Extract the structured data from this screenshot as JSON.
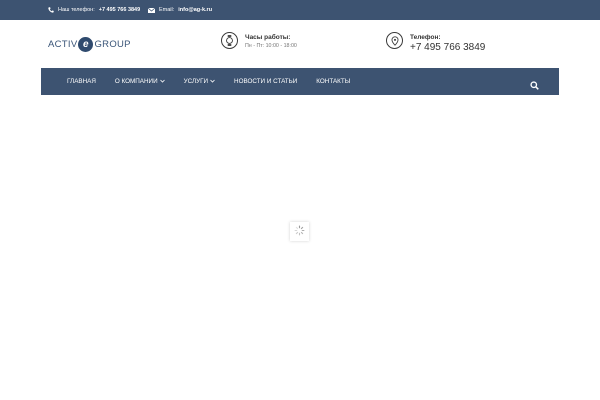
{
  "topbar": {
    "phone_label": "Наш телефон:",
    "phone_value": "+7 495 766 3849",
    "email_label": "Email:",
    "email_value": "info@ag-k.ru"
  },
  "header": {
    "logo": {
      "part1": "ACTIV",
      "part2": "e",
      "part3": "GROUP"
    },
    "hours": {
      "title": "Часы работы:",
      "value": "Пн - Пт: 10:00 - 18:00"
    },
    "phone": {
      "title": "Телефон:",
      "value": "+7 495 766 3849"
    }
  },
  "nav": {
    "items": [
      {
        "label": "ГЛАВНАЯ",
        "dropdown": false
      },
      {
        "label": "О КОМПАНИИ",
        "dropdown": true
      },
      {
        "label": "УСЛУГИ",
        "dropdown": true
      },
      {
        "label": "НОВОСТИ И СТАТЬИ",
        "dropdown": false
      },
      {
        "label": "КОНТАКТЫ",
        "dropdown": false
      }
    ]
  },
  "colors": {
    "brand": "#3d5371",
    "text": "#333333",
    "muted": "#777777"
  },
  "icons": {
    "phone": "phone-icon",
    "email": "envelope-icon",
    "hours": "watch-icon",
    "location": "location-pin-icon",
    "search": "search-icon",
    "loader": "spinner-icon"
  }
}
